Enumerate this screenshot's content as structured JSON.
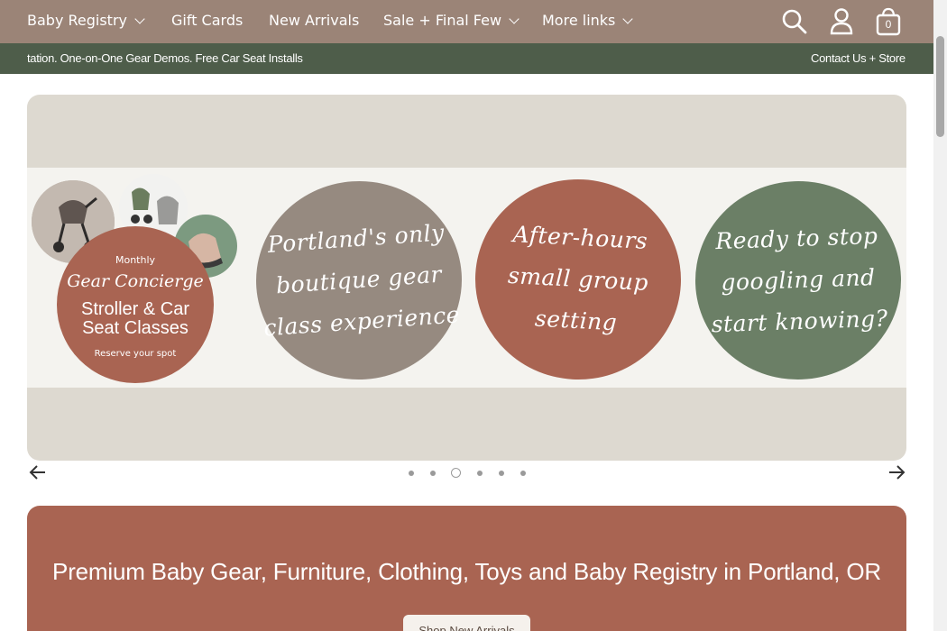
{
  "nav": {
    "items": [
      {
        "label": "Baby Registry",
        "has_dropdown": true
      },
      {
        "label": "Gift Cards",
        "has_dropdown": false
      },
      {
        "label": "New Arrivals",
        "has_dropdown": false
      },
      {
        "label": "Sale + Final Few",
        "has_dropdown": true
      },
      {
        "label": "More links",
        "has_dropdown": true
      }
    ],
    "icons": [
      "search-icon",
      "account-icon",
      "cart-icon"
    ],
    "cart_count": "0"
  },
  "announcement": {
    "left_text": "tation. One-on-One Gear Demos. Free Car Seat Installs",
    "right_text": "Contact Us + Store H"
  },
  "hero": {
    "promo": {
      "monthly": "Monthly",
      "gear": "Gear Concierge",
      "classes_line1": "Stroller & Car",
      "classes_line2": "Seat Classes",
      "reserve": "Reserve your spot"
    },
    "circles": [
      {
        "line1": "Portland's only",
        "line2": "boutique gear",
        "line3": "class experience"
      },
      {
        "line1": "After-hours",
        "line2": "small group",
        "line3": "setting"
      },
      {
        "line1": "Ready to stop",
        "line2": "googling and",
        "line3": "start knowing?"
      }
    ],
    "colors": {
      "background": "#ddd9d0",
      "band": "#f4f3ef",
      "taupe": "#968a80",
      "terracotta": "#a96452",
      "sage": "#6b7f66"
    }
  },
  "carousel": {
    "slide_count": 6,
    "active_slide": 3
  },
  "banner": {
    "title": "Premium Baby Gear, Furniture, Clothing, Toys and Baby Registry in Portland, OR",
    "button_label": "Shop New Arrivals"
  },
  "colors": {
    "nav_bg": "#9b8477",
    "announce_bg": "#4e5d4a",
    "accent": "#a96452"
  }
}
